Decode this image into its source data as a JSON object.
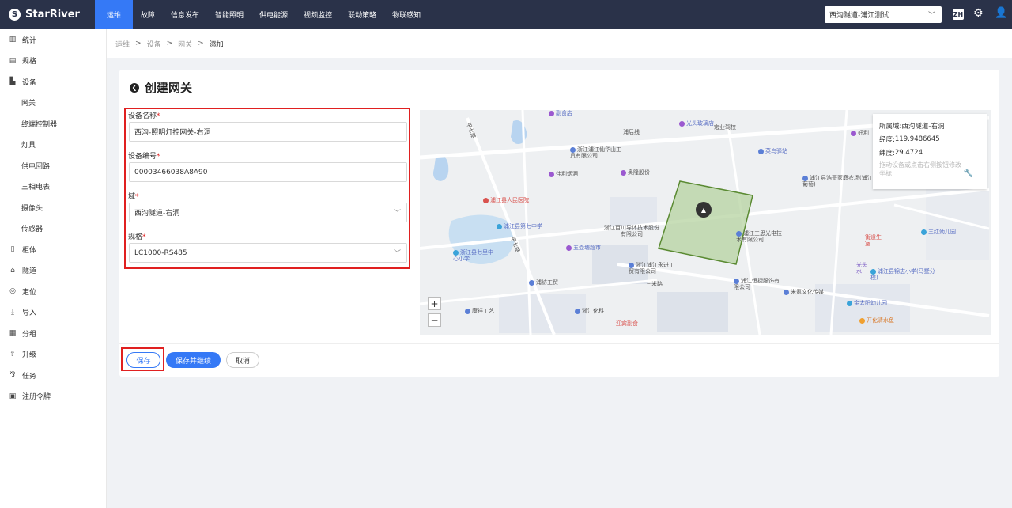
{
  "app": {
    "logo_text": "StarRiver"
  },
  "nav": {
    "items": [
      "运维",
      "故障",
      "信息发布",
      "智能照明",
      "供电能源",
      "视频监控",
      "联动策略",
      "物联感知"
    ],
    "active": "运维"
  },
  "header": {
    "region_select": "西沟隧道-浦江测试",
    "lang": "ZH"
  },
  "sidebar": {
    "items": [
      {
        "label": "统计",
        "icon": "chart-icon"
      },
      {
        "label": "规格",
        "icon": "spec-icon"
      },
      {
        "label": "设备",
        "icon": "device-icon"
      },
      {
        "label": "网关",
        "sub": true
      },
      {
        "label": "终端控制器",
        "sub": true
      },
      {
        "label": "灯具",
        "sub": true
      },
      {
        "label": "供电回路",
        "sub": true
      },
      {
        "label": "三相电表",
        "sub": true
      },
      {
        "label": "摄像头",
        "sub": true
      },
      {
        "label": "传感器",
        "sub": true
      },
      {
        "label": "柜体",
        "icon": "cabinet-icon"
      },
      {
        "label": "隧道",
        "icon": "tunnel-icon"
      },
      {
        "label": "定位",
        "icon": "location-icon"
      },
      {
        "label": "导入",
        "icon": "import-icon"
      },
      {
        "label": "分组",
        "icon": "group-icon"
      },
      {
        "label": "升级",
        "icon": "upgrade-icon"
      },
      {
        "label": "任务",
        "icon": "task-icon"
      },
      {
        "label": "注册令牌",
        "icon": "token-icon"
      }
    ]
  },
  "breadcrumb": {
    "items": [
      "运维",
      "设备",
      "网关",
      "添加"
    ]
  },
  "page": {
    "title": "创建网关"
  },
  "form": {
    "name_label": "设备名称",
    "name_value": "西沟-照明灯控网关-右洞",
    "code_label": "设备编号",
    "code_value": "00003466038A8A90",
    "domain_label": "域",
    "domain_value": "西沟隧道-右洞",
    "spec_label": "规格",
    "spec_value": "LC1000-RS485",
    "required_mark": "*"
  },
  "map": {
    "info": {
      "domain_label": "所属域: ",
      "domain_value": "西沟隧道-右洞",
      "lng_label": "经度: ",
      "lng_value": "119.9486645",
      "lat_label": "纬度: ",
      "lat_value": "29.4724",
      "hint": "拖动设备或点击右侧按钮修改坐标"
    },
    "zoom_in": "+",
    "zoom_out": "−",
    "labels": {
      "l1": "副食店",
      "l2": "光头玻璃店",
      "l3": "浦后线",
      "l4": "浙江浦江仙华山工具有限公司",
      "l5": "宏业驾校",
      "l6": "菜鸟驿站",
      "l7": "伟利烟酒",
      "l8": "奥隆股份",
      "l9": "浦江县浩哥家庭农场(浦江葡萄)",
      "l10": "浦江县人民医院",
      "l11": "浦江县第七中学",
      "l12": "浙江百川导体技术股份有限公司",
      "l13": "浦江三思光电技术有限公司",
      "l14": "三红幼儿园",
      "l15": "五壶塘超市",
      "l16": "浙江县七里中心小学",
      "l17": "浙江浦江永进工贸有限公司",
      "l18": "浦纺工贸",
      "l19": "三米路",
      "l20": "浦江恒捷服饰有限公司",
      "l21": "米氪文化传媒",
      "l22": "浦江县锦志小学(马墅分校)",
      "l23": "金太阳幼儿园",
      "l24": "康祥工艺",
      "l25": "浙江化科",
      "l26": "迎宾副食",
      "l27": "开化清水鱼",
      "l28": "平七路",
      "l29": "平七路",
      "l30": "好利",
      "l31": "街道生室",
      "l32": "光头水"
    }
  },
  "actions": {
    "save": "保存",
    "save_continue": "保存并继续",
    "cancel": "取消"
  }
}
